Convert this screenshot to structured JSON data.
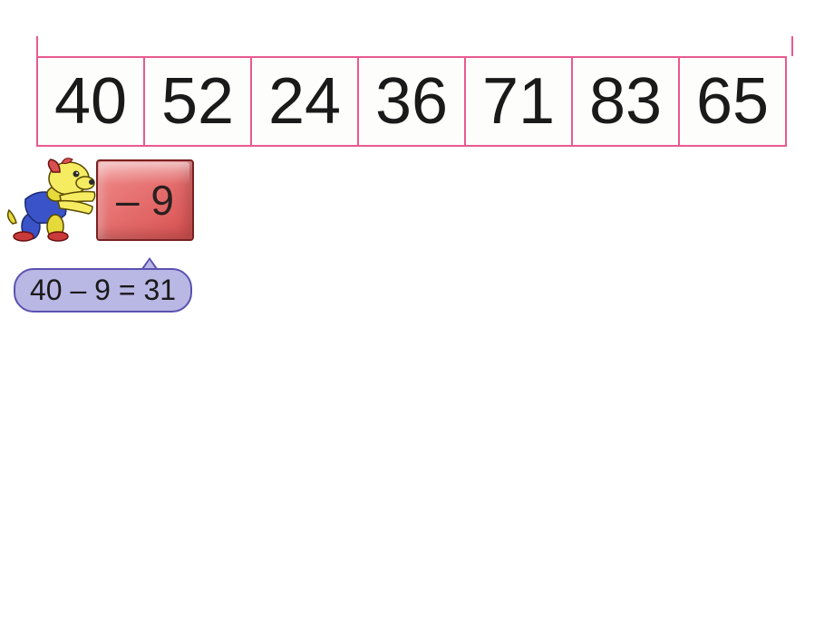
{
  "number_row": {
    "cells": [
      "40",
      "52",
      "24",
      "36",
      "71",
      "83",
      "65"
    ]
  },
  "operator_cube": {
    "label": "– 9"
  },
  "equation": {
    "text": "40 – 9 = 31"
  },
  "character": {
    "name": "cartoon-dog"
  },
  "colors": {
    "cell_border": "#e85a8f",
    "cube_fill": "#e06a6a",
    "bubble_fill": "#b9b7e4",
    "bubble_border": "#5a52b0"
  }
}
